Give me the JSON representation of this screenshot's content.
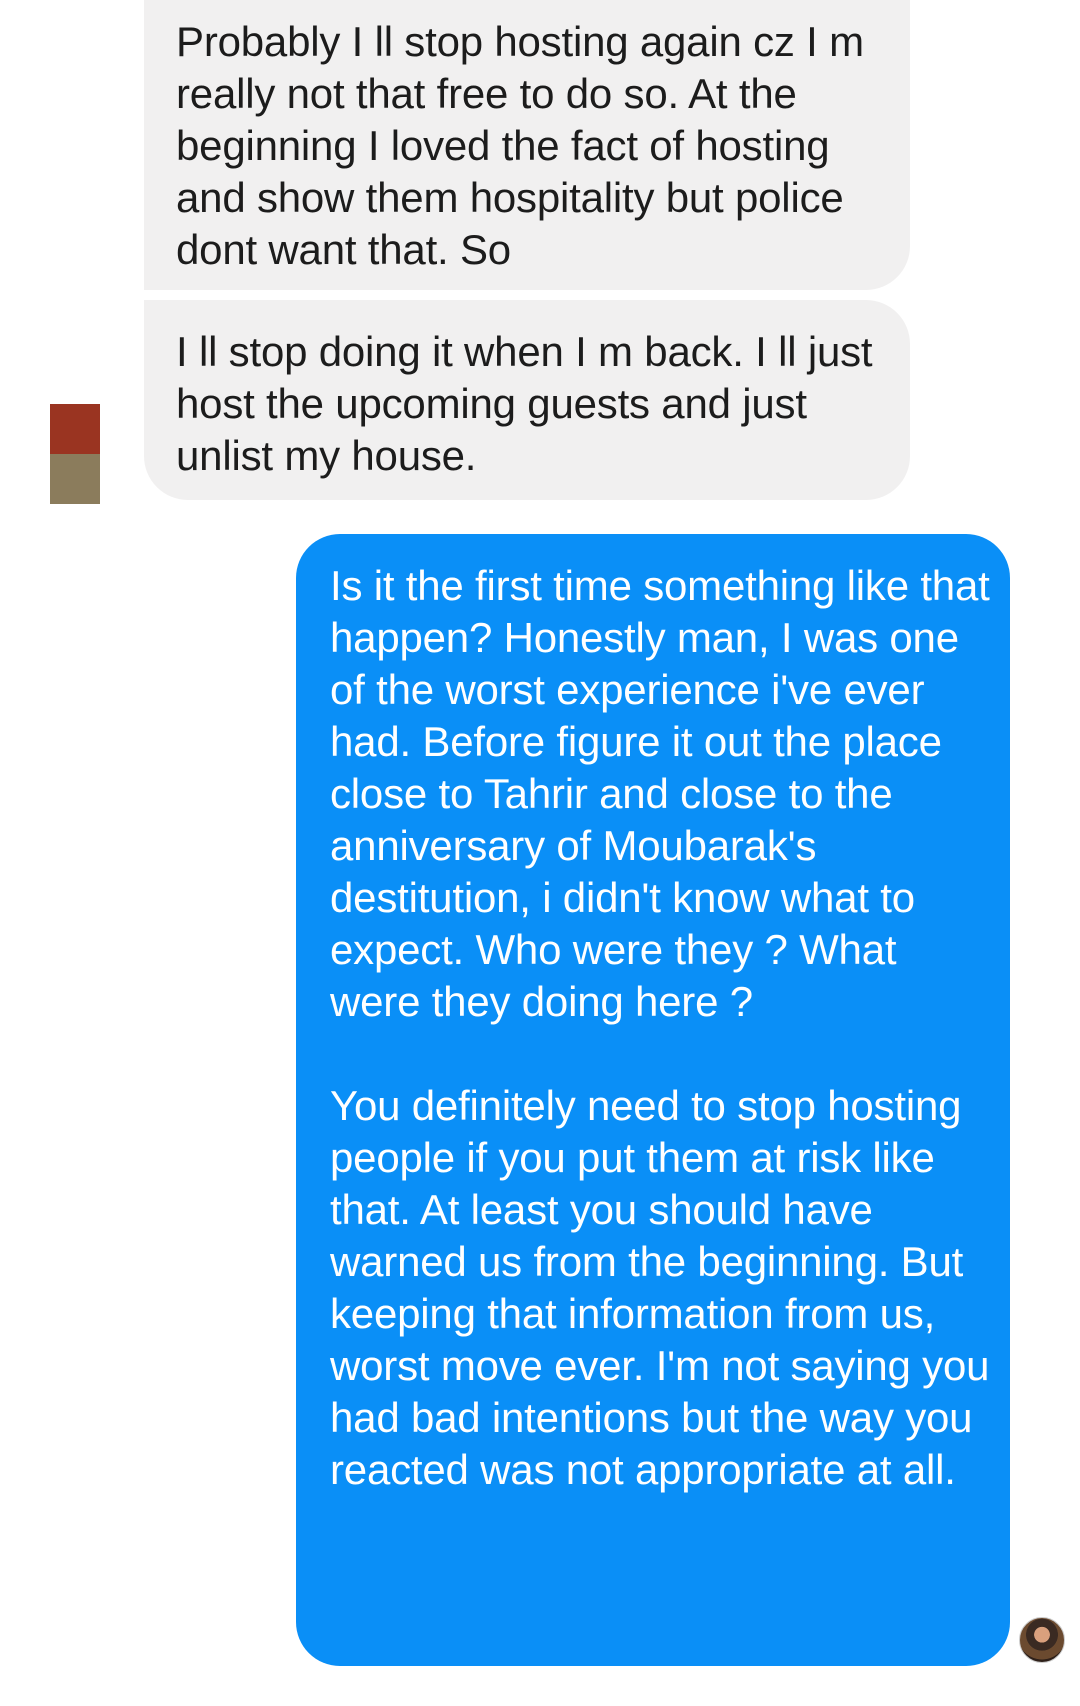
{
  "conversation": {
    "messages": [
      {
        "sender": "other",
        "text": "Probably I ll stop hosting again cz I m really not that free to do so. At the beginning I loved the fact of hosting and show them hospitality but police dont want that. So"
      },
      {
        "sender": "other",
        "text": "I ll stop doing it when I m back. I ll just host the upcoming guests and just unlist my house."
      },
      {
        "sender": "me",
        "text": "Is it the first time something like that happen? Honestly man, I was one of the worst experience i've ever had. Before figure it out the place close to Tahrir and close to the anniversary of Moubarak's destitution, i didn't know what to expect. Who were they ? What were they doing here ?\n\nYou definitely need to stop hosting people if you put them at risk like that. At least you should have warned us from the beginning. But keeping that information from us, worst move ever. I'm not saying you had bad intentions but the way you reacted was not appropriate at all."
      }
    ]
  },
  "colors": {
    "incoming_bubble": "#f1f0f0",
    "outgoing_bubble": "#0a8ff7",
    "incoming_text": "#1c1c1c",
    "outgoing_text": "#ffffff"
  }
}
